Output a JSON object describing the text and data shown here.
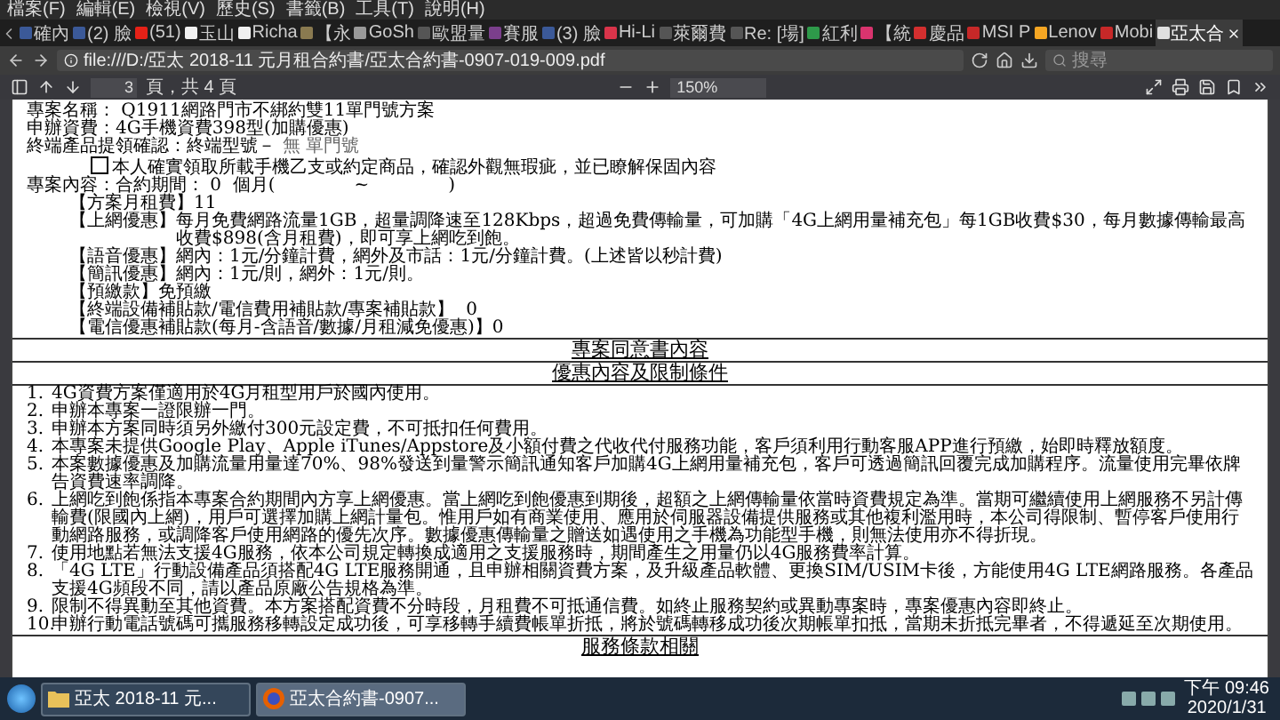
{
  "menu": [
    "檔案(F)",
    "編輯(E)",
    "檢視(V)",
    "歷史(S)",
    "書籤(B)",
    "工具(T)",
    "說明(H)"
  ],
  "tabs": [
    {
      "label": "確內",
      "selected": false,
      "color": "#3b5998"
    },
    {
      "label": "(2) 臉",
      "selected": false,
      "color": "#3b5998"
    },
    {
      "label": "(51)",
      "selected": false,
      "color": "#e62117"
    },
    {
      "label": "玉山",
      "selected": false,
      "color": "#f0f0f0"
    },
    {
      "label": "Richa",
      "selected": false,
      "color": "#f0f0f0"
    },
    {
      "label": "【永",
      "selected": false,
      "color": "#8a7a50"
    },
    {
      "label": "GoSh",
      "selected": false,
      "color": "#9a9a9a"
    },
    {
      "label": "歐盟量",
      "selected": false,
      "color": "#555555"
    },
    {
      "label": "賽服",
      "selected": false,
      "color": "#7b3f8c"
    },
    {
      "label": "(3) 臉",
      "selected": false,
      "color": "#3b5998"
    },
    {
      "label": "Hi-Li",
      "selected": false,
      "color": "#d9344a"
    },
    {
      "label": "萊爾費",
      "selected": false,
      "color": "#555555"
    },
    {
      "label": "Re: [場]",
      "selected": false,
      "color": "#555555"
    },
    {
      "label": "紅利",
      "selected": false,
      "color": "#2e9a4a"
    },
    {
      "label": "【統",
      "selected": false,
      "color": "#d9346e"
    },
    {
      "label": "慶品",
      "selected": false,
      "color": "#d32f2f"
    },
    {
      "label": "MSI P",
      "selected": false,
      "color": "#c62828"
    },
    {
      "label": "Lenov",
      "selected": false,
      "color": "#f5a623"
    },
    {
      "label": "Mobi",
      "selected": false,
      "color": "#c62828"
    },
    {
      "label": "亞太合",
      "selected": true,
      "color": "#e0e0e0"
    }
  ],
  "address": "file:///D:/亞太 2018-11 元月租合約書/亞太合約書-0907-019-009.pdf",
  "search": {
    "placeholder": "搜尋"
  },
  "pdf_toolbar": {
    "page": "3",
    "page_count": "頁，共 4 頁",
    "zoom": "150%"
  },
  "document": {
    "info": [
      {
        "label": "專案名稱：",
        "value": " Q1911網路門市不綁約雙11單門號方案"
      },
      {
        "label": "申辦資費：",
        "value": "4G手機資費398型(加購優惠)"
      },
      {
        "label": "終端產品提領確認：",
        "value": "終端型號－",
        "note": "無 單門號"
      }
    ],
    "checkbox": {
      "checked": false,
      "label": "本人確實領取所載手機乙支或約定商品，確認外觀無瑕疵，並已瞭解保固內容"
    },
    "contract": "專案內容：合約期間： 0  個月(              ~              )",
    "benefits": [
      {
        "title": "【方案月租費】",
        "text": "11"
      },
      {
        "title": "【上網優惠】",
        "text": "每月免費網路流量1GB，超量調降速至128Kbps，超過免費傳輸量，可加購「4G上網用量補充包」每1GB收費$30，每月數據傳輸最高收費$898(含月租費)，即可享上網吃到飽。"
      },
      {
        "title": "【語音優惠】",
        "text": "網內：1元/分鐘計費，網外及市話：1元/分鐘計費。(上述皆以秒計費)"
      },
      {
        "title": "【簡訊優惠】",
        "text": "網內：1元/則，網外：1元/則。"
      },
      {
        "title": "【預繳款】",
        "text": "免預繳"
      },
      {
        "title": "【終端設備補貼款/電信費用補貼款/專案補貼款】",
        "text": "  0"
      },
      {
        "title": "【電信優惠補貼款(每月-含語音/數據/月租減免優惠)】",
        "text": "0"
      }
    ],
    "sections": [
      "專案同意書內容",
      "優惠內容及限制條件"
    ],
    "terms": [
      {
        "num": "1.",
        "text": "4G資費方案僅適用於4G月租型用戶於國內使用。"
      },
      {
        "num": "2.",
        "text": "申辦本專案一證限辦一門。"
      },
      {
        "num": "3.",
        "text": "申辦本方案同時須另外繳付300元設定費，不可抵扣任何費用。"
      },
      {
        "num": "4.",
        "text": "本專案未提供Google Play、Apple iTunes/Appstore及小額付費之代收代付服務功能，客戶須利用行動客服APP進行預繳，始即時釋放額度。"
      },
      {
        "num": "5.",
        "text": "本案數據優惠及加購流量用量達70%、98%發送到量警示簡訊通知客戶加購4G上網用量補充包，客戶可透過簡訊回覆完成加購程序。流量使用完畢依牌告資費速率調降。"
      },
      {
        "num": "6.",
        "text": "上網吃到飽係指本專案合約期間內方享上網優惠。當上網吃到飽優惠到期後，超額之上網傳輸量依當時資費規定為準。當期可繼續使用上網服務不另計傳輸費(限國內上網)，用戶可選擇加購上網計量包。惟用戶如有商業使用、應用於伺服器設備提供服務或其他複利濫用時，本公司得限制、暫停客戶使用行動網路服務，或調降客戶使用網路的優先次序。數據優惠傳輸量之贈送如遇使用之手機為功能型手機，則無法使用亦不得折現。"
      },
      {
        "num": "7.",
        "text": "使用地點若無法支援4G服務，依本公司規定轉換成適用之支援服務時，期間產生之用量仍以4G服務費率計算。"
      },
      {
        "num": "8.",
        "text": "「4G LTE」行動設備產品須搭配4G LTE服務開通，且申辦相關資費方案，及升級產品軟體、更換SIM/USIM卡後，方能使用4G LTE網路服務。各產品支援4G頻段不同，請以產品原廠公告規格為準。"
      },
      {
        "num": "9.",
        "text": "限制不得異動至其他資費。本方案搭配資費不分時段，月租費不可抵通信費。如終止服務契約或異動專案時，專案優惠內容即終止。"
      },
      {
        "num": "10.",
        "text": "申辦行動電話號碼可攜服務移轉設定成功後，可享移轉手續費帳單折抵，將於號碼轉移成功後次期帳單扣抵，當期未折抵完畢者，不得遞延至次期使用。"
      }
    ],
    "next_section": "服務條款相關"
  },
  "taskbar": {
    "windows": [
      {
        "label": "亞太 2018-11 元...",
        "selected": false,
        "kind": "folder"
      },
      {
        "label": "亞太合約書-0907...",
        "selected": true,
        "kind": "browser"
      }
    ],
    "time": "下午 09:46",
    "date": "2020/1/31"
  }
}
